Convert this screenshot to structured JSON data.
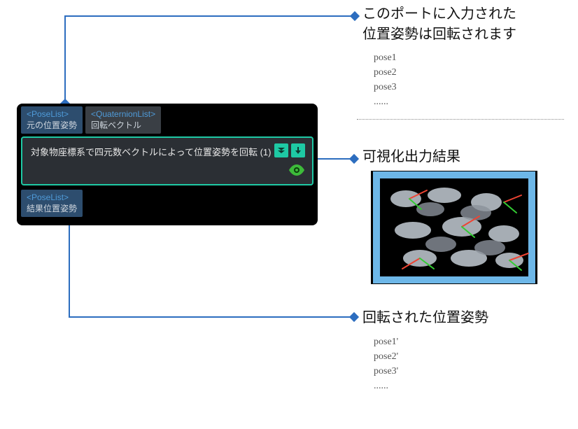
{
  "node": {
    "input_ports": [
      {
        "type": "<PoseList>",
        "label": "元の位置姿勢",
        "selected": true
      },
      {
        "type": "<QuaternionList>",
        "label": "回転ベクトル",
        "selected": false
      }
    ],
    "title": "対象物座標系で四元数ベクトルによって位置姿勢を回転 (1)",
    "output_ports": [
      {
        "type": "<PoseList>",
        "label": "結果位置姿勢",
        "selected": true
      }
    ]
  },
  "callouts": {
    "input": {
      "title_l1": "このポートに入力された",
      "title_l2": "位置姿勢は回転されます",
      "poses": [
        "pose1",
        "pose2",
        "pose3",
        "......"
      ]
    },
    "viz": {
      "title": "可視化出力結果"
    },
    "output": {
      "title": "回転された位置姿勢",
      "poses": [
        "pose1'",
        "pose2'",
        "pose3'",
        "......"
      ]
    }
  }
}
